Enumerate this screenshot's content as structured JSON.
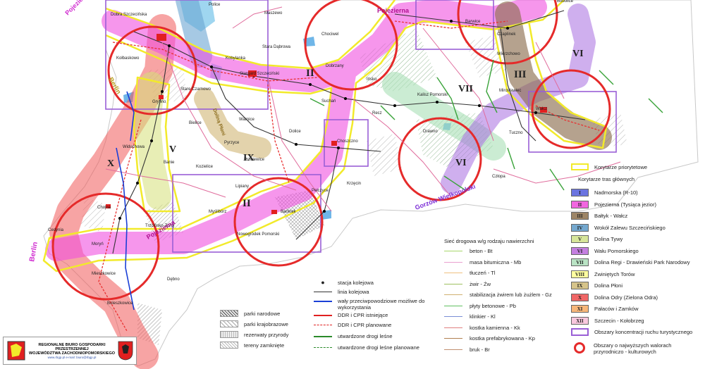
{
  "map": {
    "place_labels": [
      "Dobra Szczecińska",
      "Maszewo",
      "Police",
      "Stara Dąbrowa",
      "Chociwel",
      "Czaplinek",
      "Barwice",
      "Bobolice",
      "Kołbaskowo",
      "Kobylanka",
      "Stargard Szczeciński",
      "Dobrzany",
      "Stare Czarnowo",
      "Gryfino",
      "Bielice",
      "Warnice",
      "Suchań",
      "Ińsko",
      "Kalisz Pomorski",
      "Mirosławiec",
      "Wierzchowo",
      "Wałcz",
      "Dolice",
      "Recz",
      "Drawno",
      "Tuczno",
      "Widuchowa",
      "Pyrzyce",
      "Przelewice",
      "Choszczno",
      "Kozielice",
      "Banie",
      "Lipiany",
      "Pełczyce",
      "Krzęcin",
      "Człopa",
      "Chojna",
      "Myślibórz",
      "Barlinek",
      "Cedynia",
      "Trzcińsko-Zdrój",
      "Nowogródek Pomorski",
      "Moryń",
      "Mieszkowice",
      "Dębno",
      "Boleszkowice"
    ],
    "edge_labels": [
      "Berlin",
      "Berlin",
      "Gorzów Wielkopolski",
      "Pojezierze Meklemb."
    ],
    "corridor_labels": [
      "II",
      "II",
      "III",
      "V",
      "VI",
      "VI",
      "VII",
      "IX",
      "X",
      "Pojezierna",
      "Pojezierna",
      "Doliną Płoni",
      "Berlin"
    ]
  },
  "legend_right": {
    "priority_label": "Korytarze priorytetowe",
    "corridors_title": "Korytarze tras głównych",
    "corridors": [
      {
        "code": "I",
        "name": "Nadmorska (R-10)",
        "color": "#6b74e0"
      },
      {
        "code": "II",
        "name": "Pojezierna (Tysiąca jezior)",
        "color": "#f266e0"
      },
      {
        "code": "III",
        "name": "Bałtyk - Wałcz",
        "color": "#9d8566"
      },
      {
        "code": "IV",
        "name": "Wokół Zalewu Szczecińskiego",
        "color": "#74a8cf"
      },
      {
        "code": "V",
        "name": "Dolina Tywy",
        "color": "#d7e69a"
      },
      {
        "code": "VI",
        "name": "Wału Pomorskiego",
        "color": "#c47fe0"
      },
      {
        "code": "VII",
        "name": "Dolina Regi - Drawieński Park Narodowy",
        "color": "#b9e3c4"
      },
      {
        "code": "VIII",
        "name": "Zwiniętych Torów",
        "color": "#ffffa0"
      },
      {
        "code": "IX",
        "name": "Dolina Płoni",
        "color": "#d6c48a"
      },
      {
        "code": "X",
        "name": "Dolina Odry (Zielona Odra)",
        "color": "#f06666"
      },
      {
        "code": "XI",
        "name": "Pałaców i Zamków",
        "color": "#f7b77a"
      },
      {
        "code": "XII",
        "name": "Szczecin - Kołobrzeg",
        "color": "#f9c8de"
      }
    ],
    "concentration_label": "Obszary koncentracji ruchu turystycznego",
    "value_label": "Obszary o najwyższych walorach przyrodniczo - kulturowych"
  },
  "legend_roads": {
    "title": "Sieć drogowa w/g rodzaju nawierzchni",
    "items": [
      {
        "label": "beton - Bt",
        "color": "#a6d66a"
      },
      {
        "label": "masa bitumiczna - Mb",
        "color": "#e9a0d0"
      },
      {
        "label": "tłuczeń - Tl",
        "color": "#f0c080"
      },
      {
        "label": "żwir - Żw",
        "color": "#9ec060"
      },
      {
        "label": "stabilizacja żwirem lub żużlem - Gz",
        "color": "#d0b070"
      },
      {
        "label": "płyty betonowe - Pb",
        "color": "#60c060"
      },
      {
        "label": "klinkier - Kl",
        "color": "#7a8ed6"
      },
      {
        "label": "kostka kamienna - Kk",
        "color": "#e08080"
      },
      {
        "label": "kostka prefabrykowana - Kp",
        "color": "#b08050"
      },
      {
        "label": "bruk - Br",
        "color": "#c09070"
      }
    ]
  },
  "legend_rail": {
    "items": [
      "stacja kolejowa",
      "linia kolejowa",
      "wały przeciwpowodziowe możliwe do wykorzystania",
      "DDR i CPR istniejące",
      "DDR i CPR planowane",
      "utwardzone drogi leśne",
      "utwardzone drogi leśne planowane"
    ]
  },
  "legend_areas": {
    "items": [
      "parki narodowe",
      "parki krajobrazowe",
      "rezerwaty przyrody",
      "tereny zamknięte"
    ]
  },
  "logo": {
    "line1": "REGIONALNE BIURO GOSPODARKI PRZESTRZENNEJ",
    "line2": "WOJEWÓDZTWA ZACHODNIOPOMORSKIEGO",
    "url": "www.rbgp.pl  e-mail: biuro@rbgp.pl"
  }
}
